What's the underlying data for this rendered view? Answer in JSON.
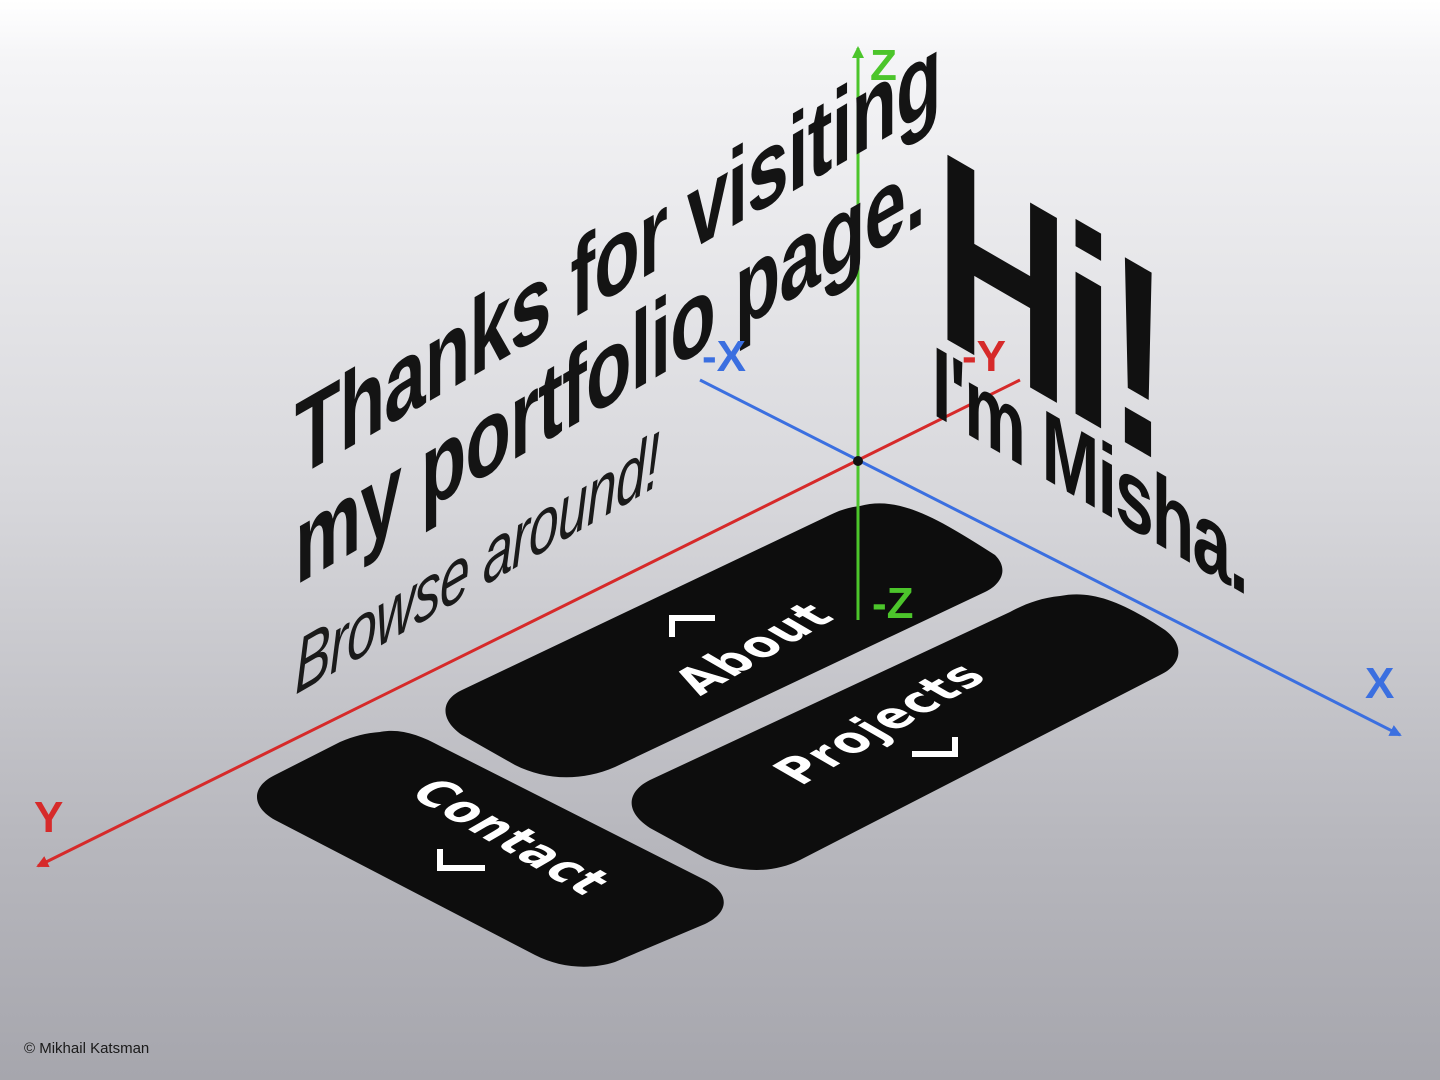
{
  "heading": {
    "line1": "Thanks for visiting",
    "line2": "my portfolio page.",
    "sub": "Browse around!"
  },
  "greeting": {
    "hi": "Hi!",
    "name": "I'm Misha."
  },
  "nav": [
    {
      "label": "About",
      "icon": "chevron-up-icon"
    },
    {
      "label": "Projects",
      "icon": "chevron-down-icon"
    },
    {
      "label": "Contact",
      "icon": "chevron-down-icon"
    }
  ],
  "axes": {
    "z": "Z",
    "neg_z": "-Z",
    "x": "X",
    "neg_x": "-X",
    "y": "Y",
    "neg_y": "-Y"
  },
  "colors": {
    "x_axis": "#3b6fe0",
    "y_axis": "#d62a2a",
    "z_axis": "#4cc52b",
    "button_fill": "#0d0d0d"
  },
  "footer": {
    "copyright": "© Mikhail Katsman"
  }
}
